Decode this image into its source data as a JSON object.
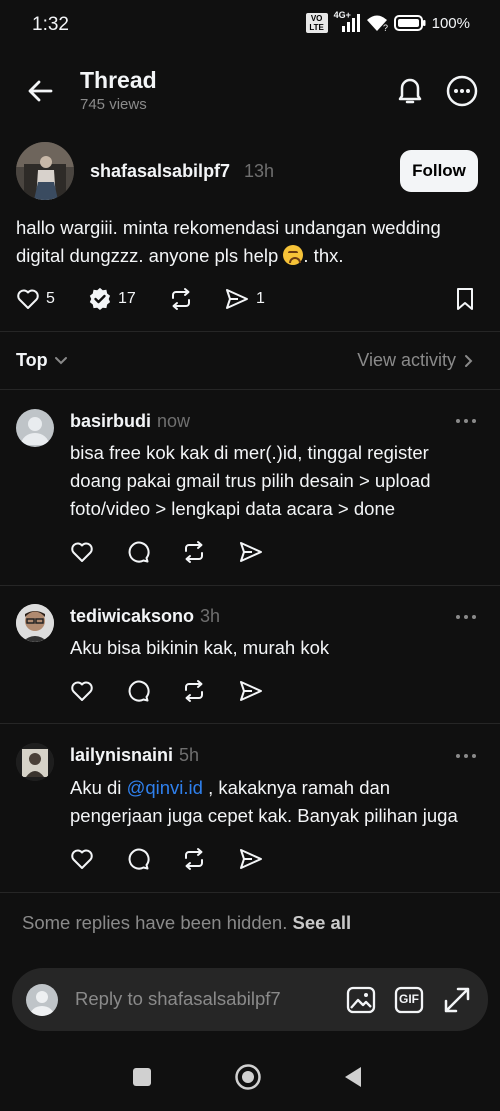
{
  "status_bar": {
    "time": "1:32",
    "network_badge": "VO LTE",
    "network_type": "4G+",
    "battery": "100%"
  },
  "header": {
    "title": "Thread",
    "views": "745 views"
  },
  "post": {
    "author": "shafasalsabilpf7",
    "time": "13h",
    "follow_label": "Follow",
    "text_before_emoji": "hallo wargiii. minta rekomendasi undangan wedding digital dungzzz. anyone pls help",
    "text_after_emoji": ". thx.",
    "likes": "5",
    "reposts": "17",
    "shares": "1"
  },
  "sort": {
    "label": "Top",
    "view_activity": "View activity"
  },
  "replies": [
    {
      "username": "basirbudi",
      "time": "now",
      "text": "bisa free kok kak di mer(.)id, tinggal register doang pakai gmail trus pilih desain > upload foto/video > lengkapi data acara > done"
    },
    {
      "username": "tediwicaksono",
      "time": "3h",
      "text": "Aku bisa bikinin kak, murah kok"
    },
    {
      "username": "lailynisnaini",
      "time": "5h",
      "text_before_link": "Aku di ",
      "link": "@qinvi.id",
      "text_after_link": " , kakaknya ramah dan pengerjaan juga cepet kak. Banyak pilihan juga"
    }
  ],
  "hidden_notice": {
    "text": "Some replies have been hidden.",
    "link": "See all"
  },
  "composer": {
    "placeholder": "Reply to shafasalsabilpf7",
    "gif_label": "GIF"
  },
  "colors": {
    "background": "#101010",
    "text": "#f3f5f7",
    "muted": "#8a8a8a",
    "link": "#2f80ed",
    "composer_bg": "#262626"
  }
}
